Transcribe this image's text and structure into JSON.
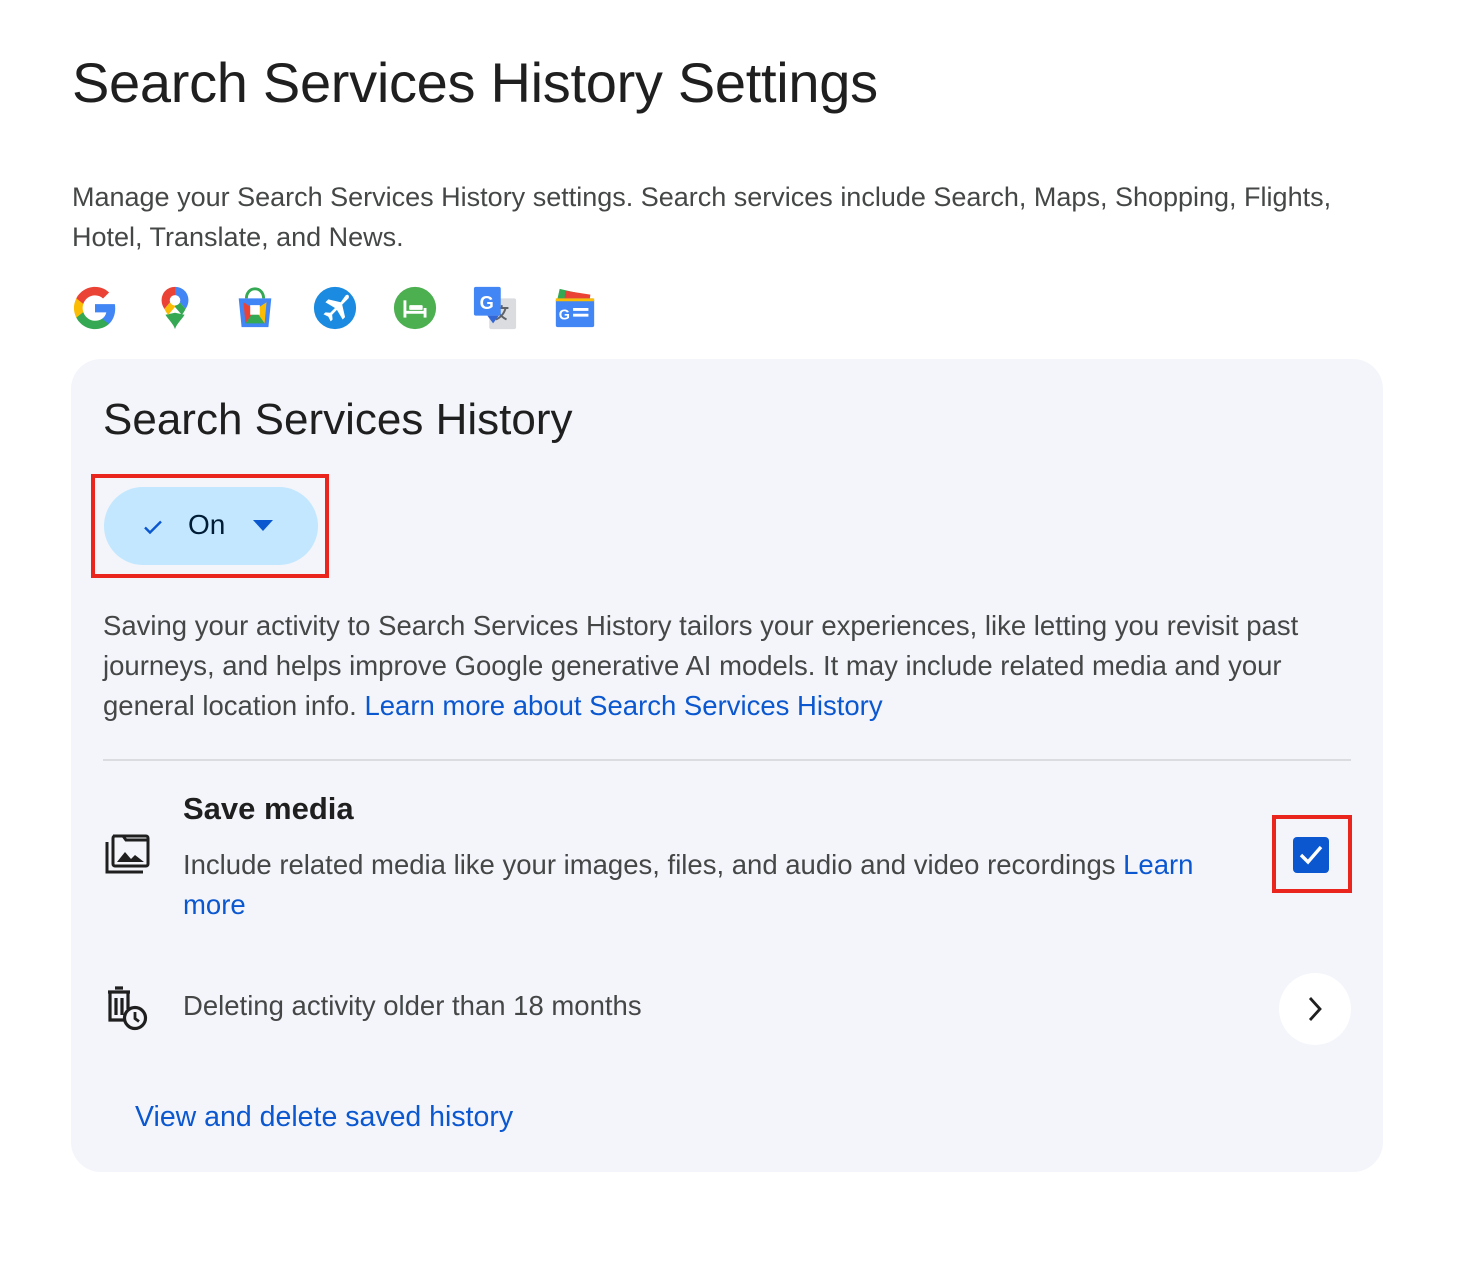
{
  "page": {
    "title": "Search Services History Settings",
    "intro": "Manage your Search Services History settings. Search services include Search, Maps, Shopping, Flights, Hotel, Translate, and News."
  },
  "services": [
    {
      "name": "google-search-icon"
    },
    {
      "name": "google-maps-icon"
    },
    {
      "name": "google-shopping-icon"
    },
    {
      "name": "google-flights-icon"
    },
    {
      "name": "google-hotels-icon"
    },
    {
      "name": "google-translate-icon"
    },
    {
      "name": "google-news-icon"
    }
  ],
  "card": {
    "title": "Search Services History",
    "status_chip": {
      "label": "On",
      "icons": [
        "check-icon",
        "caret-down-icon"
      ]
    },
    "description": "Saving your activity to Search Services History tailors your experiences, like letting you revisit past journeys, and helps improve Google generative AI models. It may include related media and your general location info.",
    "description_link": "Learn more about Search Services History",
    "save_media": {
      "title": "Save media",
      "description": "Include related media like your images, files, and audio and video recordings",
      "link": "Learn more",
      "checked": true,
      "icon": "photo-library-icon"
    },
    "auto_delete": {
      "text": "Deleting activity older than 18 months",
      "icon": "auto-delete-icon"
    },
    "view_link": "View and delete saved history"
  },
  "colors": {
    "accent_blue": "#0b57d0",
    "chip_bg": "#c2e7ff",
    "card_bg": "#f3f5fa",
    "highlight_red": "#e9251d"
  }
}
